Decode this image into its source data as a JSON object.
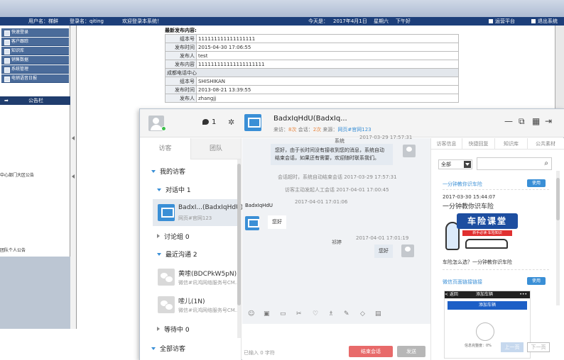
{
  "topbar": {
    "user": "用户名：梯鲜",
    "login": "登录名：qiting",
    "welcome": "欢迎登录本系统！",
    "date": "今天是：",
    "date_value": "2017年4月1日",
    "weekday": "星期六",
    "period": "下午好",
    "platform": "运营平台",
    "exit": "退出系统"
  },
  "left_sidebar": {
    "items": [
      "快速登录",
      "客户跟踪",
      "知识库",
      "销售数据",
      "系统管理",
      "电销语音日报"
    ],
    "notice_title": "公告栏",
    "notice_1": "中心部门大区公告",
    "notice_2": "团队个人公告"
  },
  "legacy": {
    "title": "最新发布内容:",
    "rows": [
      {
        "k": "组本号",
        "v": "111111111111111111"
      },
      {
        "k": "发布时间",
        "v": "2015-04-30 17:06:55"
      },
      {
        "k": "发布人",
        "v": "test"
      },
      {
        "k": "发布内容",
        "v": "111111111111111111111"
      }
    ],
    "section": "成都电话中心",
    "rows2": [
      {
        "k": "组本号",
        "v": "SHISHIKAN"
      },
      {
        "k": "发布时间",
        "v": "2013-08-21 13:39:55"
      },
      {
        "k": "发布人",
        "v": "zhangjj"
      }
    ]
  },
  "chat": {
    "header": {
      "chat_count": "1",
      "customer_name": "BadxIqHdU(BadxIq...",
      "meta_visits_label": "来访：",
      "meta_visits": "8次",
      "meta_sessions_label": "会话：",
      "meta_sessions": "2次",
      "meta_source_label": "来源：",
      "meta_source": "网页#官网123"
    },
    "left": {
      "tab_visitors": "访客",
      "tab_team": "团队",
      "my_visitors": "我的访客",
      "in_chat": "对话中 1",
      "v1_name": "BadxI...(BadxIqHdU)",
      "v1_sub": "网页#官网123",
      "discussion": "讨论组 0",
      "recent": "最近沟通 2",
      "v2_name": "黄嗦(BDCPkW5pN)",
      "v2_sub": "微信#讯鸿网络服务号CM...",
      "v3_name": "嗦儿(1N)",
      "v3_sub": "微信#讯鸿网络服务号CM...",
      "waiting": "等待中 0",
      "all_visitors": "全部访客"
    },
    "messages": {
      "t0": "2017-03-29 17:57:31",
      "sys_name": "系统",
      "sys_msg": "您好，由于长时间没有接收到您的消息，系统自动结束会话，如果还有需要，欢迎随时联系我们。",
      "notice1": "会话超时，系统自动结束会话 2017-03-29 17:57:31",
      "notice2": "访客主动发起人工会话 2017-04-01 17:00:45",
      "visitor_name": "BadxIqHdU",
      "visitor_time": "2017-04-01 17:01:06",
      "visitor_msg": "您好",
      "agent_name": "祁婷",
      "agent_time": "2017-04-01 17:01:19",
      "agent_msg": "您好",
      "input_hint": "已输入 0 字符",
      "end_btn": "结束会话",
      "send_btn": "发送"
    },
    "right": {
      "tabs": [
        "访客信息",
        "快捷回复",
        "知识库",
        "公共素材"
      ],
      "select_value": "全部",
      "item1_title": "一分钟教你识车险",
      "use_btn": "使用",
      "item1_date": "2017-03-30 15:44:07",
      "item1_sub": "一分钟教你识车险",
      "banner_title": "车险课堂",
      "banner_sub": "新手必读·车险知识",
      "item1_caption": "车险怎么选？一分钟教你识车险",
      "item2_title": "微信页面链接链接",
      "phone_back": "< 返回",
      "phone_title": "添加车辆",
      "phone_bar": "添加车辆",
      "phone_progress": "信息完整度：0%",
      "prev_btn": "上一页",
      "next_btn": "下一页"
    }
  }
}
